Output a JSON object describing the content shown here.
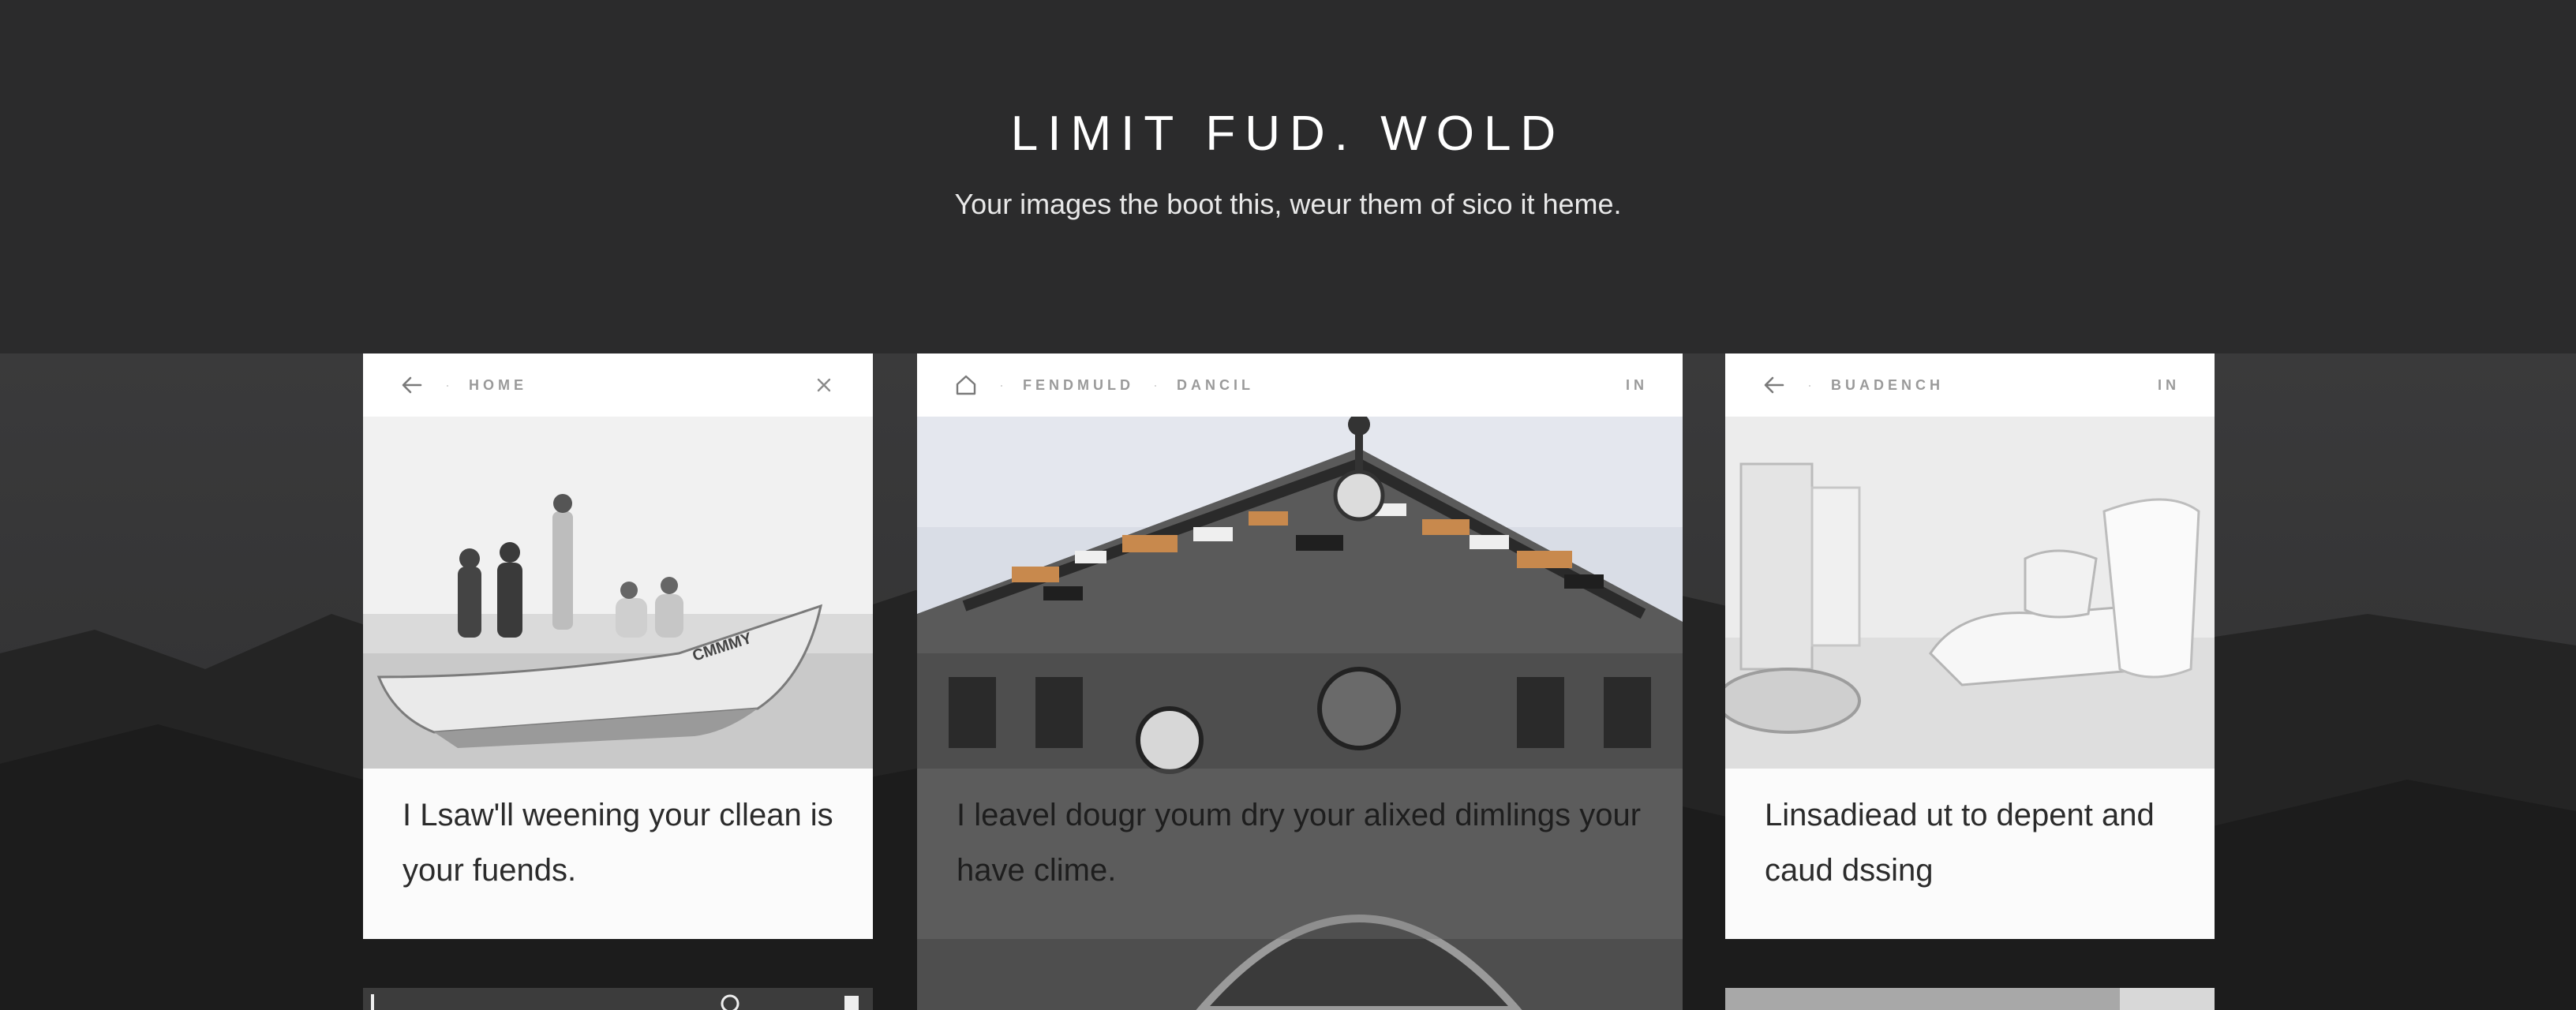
{
  "header": {
    "title": "LIMIT FUD. WOLD",
    "subtitle": "Your images the boot this, weur them of sico it heme."
  },
  "cards": [
    {
      "nav": {
        "left_icon": "arrow-left-icon",
        "label": "HOME",
        "right_icon": "close-icon"
      },
      "caption": "I Lsaw'll weening your cllean is your fuends."
    },
    {
      "nav": {
        "left_icon": "home-icon",
        "label_1": "FENDMULD",
        "label_2": "DANCIL",
        "right_label": "IN"
      },
      "caption": "I leavel dougr youm dry your alixed dimlings your have clime."
    },
    {
      "nav": {
        "left_icon": "arrow-left-icon",
        "label": "BUADENCH",
        "right_label": "IN"
      },
      "caption": "Linsadiead ut to depent and caud dssing"
    }
  ]
}
